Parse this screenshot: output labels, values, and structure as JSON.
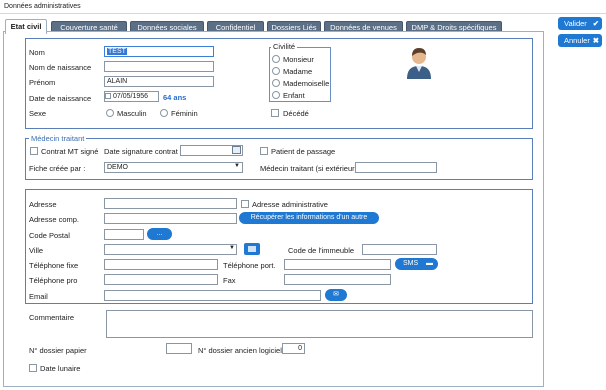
{
  "window": {
    "title": "Données administratives"
  },
  "tabs": [
    "Etat civil",
    "Couverture santé",
    "Données sociales",
    "Confidentiel",
    "Dossiers Liés",
    "Données de venues",
    "DMP & Droits spécifiques"
  ],
  "actions": {
    "validate": "Valider",
    "cancel": "Annuler"
  },
  "identity": {
    "nom_label": "Nom",
    "nom_value": "TEST",
    "naissance_label": "Nom de naissance",
    "naissance_value": "",
    "prenom_label": "Prénom",
    "prenom_value": "ALAIN",
    "dob_label": "Date de naissance",
    "dob_value": "07/05/1956",
    "age": "64 ans",
    "sexe_label": "Sexe",
    "sexe_m": "Masculin",
    "sexe_f": "Féminin",
    "decede": "Décédé"
  },
  "civilite": {
    "legend": "Civilité",
    "options": [
      "Monsieur",
      "Madame",
      "Mademoiselle",
      "Enfant"
    ]
  },
  "medecin": {
    "legend": "Médecin traitant",
    "contrat": "Contrat MT signé",
    "date_sig": "Date signature contrat",
    "passage": "Patient de passage",
    "fiche_label": "Fiche créée par :",
    "fiche_value": "DEMO",
    "ext_label": "Médecin traitant (si extérieur)"
  },
  "address": {
    "adresse": "Adresse",
    "adresse_admin": "Adresse administrative",
    "adresse_comp": "Adresse comp.",
    "recup_btn": "Récupérer les informations d'un autre",
    "cp": "Code Postal",
    "cp_btn": "...",
    "ville": "Ville",
    "code_immeuble": "Code de l'immeuble",
    "tel_fixe": "Téléphone fixe",
    "tel_port": "Téléphone port.",
    "sms_btn": "SMS",
    "tel_pro": "Téléphone pro",
    "fax": "Fax",
    "email": "Email",
    "commentaire": "Commentaire",
    "dossier_papier": "N° dossier papier",
    "dossier_ancien": "N° dossier ancien logiciel",
    "dossier_ancien_value": "0",
    "date_lunaire": "Date lunaire"
  }
}
